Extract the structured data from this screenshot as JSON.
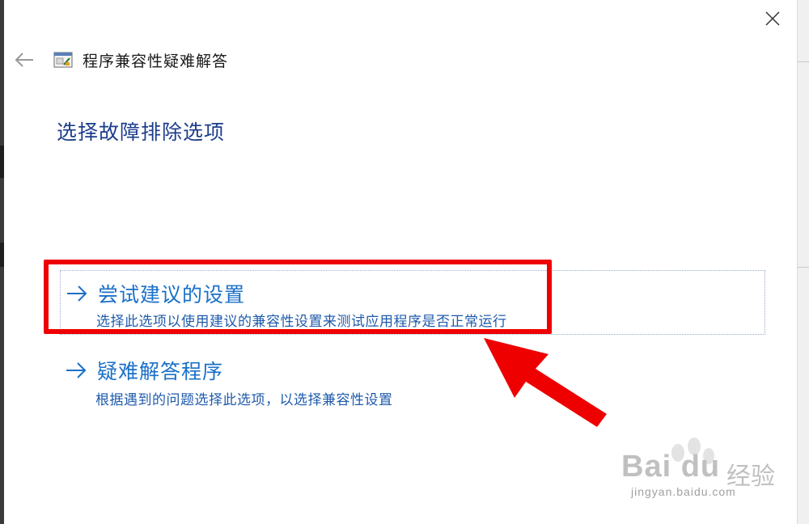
{
  "window": {
    "title": "程序兼容性疑难解答"
  },
  "page": {
    "heading": "选择故障排除选项"
  },
  "options": [
    {
      "title": "尝试建议的设置",
      "description": "选择此选项以使用建议的兼容性设置来测试应用程序是否正常运行"
    },
    {
      "title": "疑难解答程序",
      "description": "根据遇到的问题选择此选项，以选择兼容性设置"
    }
  ],
  "watermark": {
    "brand_latin": "Bai du",
    "brand_cn": "经验",
    "url": "jingyan.baidu.com"
  },
  "icons": {
    "close": "close-icon",
    "back": "back-arrow-icon",
    "app": "compatibility-troubleshooter-icon",
    "option_arrow": "right-arrow-icon"
  },
  "colors": {
    "heading": "#1c3d8c",
    "option_title": "#1a70c8",
    "option_desc": "#1f5bab",
    "annotation": "#ee0000"
  }
}
